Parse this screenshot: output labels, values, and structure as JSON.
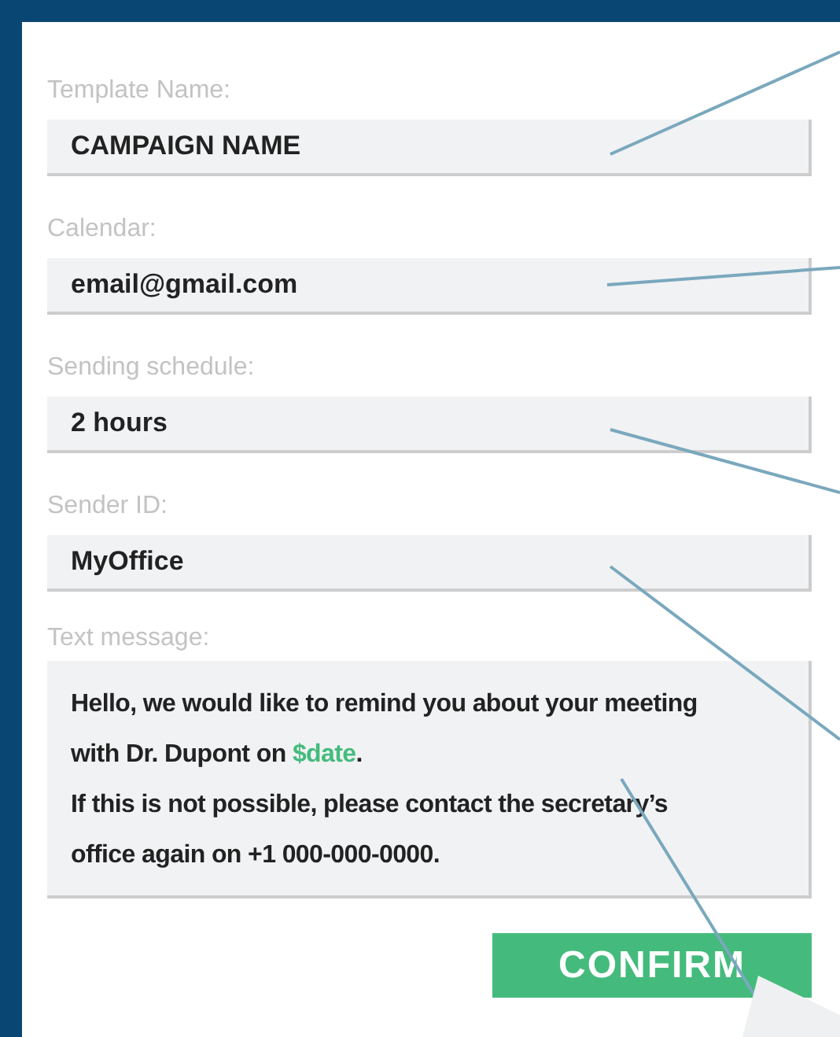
{
  "fields": [
    {
      "label": "Template Name:",
      "value": "CAMPAIGN NAME"
    },
    {
      "label": "Calendar:",
      "value": "email@gmail.com"
    },
    {
      "label": "Sending schedule:",
      "value": "2 hours"
    },
    {
      "label": "Sender ID:",
      "value": "MyOffice"
    }
  ],
  "message": {
    "label": "Text message:",
    "paragraphs": [
      [
        {
          "kind": "text",
          "text": "Hello, we would like to remind you about your meeting with Dr. Dupont on "
        },
        {
          "kind": "variable",
          "text": "$date"
        },
        {
          "kind": "text",
          "text": "."
        }
      ],
      [
        {
          "kind": "text",
          "text": "If this is not possible, please contact the secretary’s office again on +1 000-000-0000."
        }
      ]
    ]
  },
  "confirm_button": "CONFIRM"
}
